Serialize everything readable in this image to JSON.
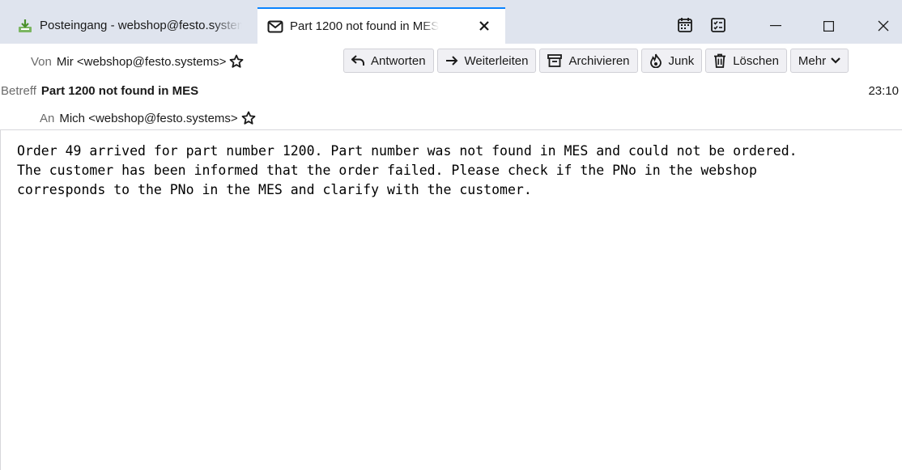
{
  "tabs": [
    {
      "label": "Posteingang - webshop@festo.systems",
      "icon": "inbox-download-icon"
    },
    {
      "label": "Part 1200 not found in MES",
      "icon": "envelope-icon",
      "close_label": "✕"
    }
  ],
  "window_controls": {
    "minimize": "—",
    "maximize": "☐",
    "close": "✕"
  },
  "header": {
    "from_label": "Von",
    "from_value": "Mir <webshop@festo.systems>",
    "subject_label": "Betreff",
    "subject_value": "Part 1200 not found in MES",
    "time": "23:10",
    "to_label": "An",
    "to_value": "Mich <webshop@festo.systems>"
  },
  "toolbar": {
    "reply": "Antworten",
    "forward": "Weiterleiten",
    "archive": "Archivieren",
    "junk": "Junk",
    "delete": "Löschen",
    "more": "Mehr"
  },
  "body": {
    "text": "Order 49 arrived for part number 1200. Part number was not found in MES and could not be ordered.\nThe customer has been informed that the order failed. Please check if the PNo in the webshop\ncorresponds to the PNo in the MES and clarify with the customer."
  },
  "colors": {
    "tab_accent": "#0a84ff",
    "tabbar_bg": "#dfe4ee"
  }
}
